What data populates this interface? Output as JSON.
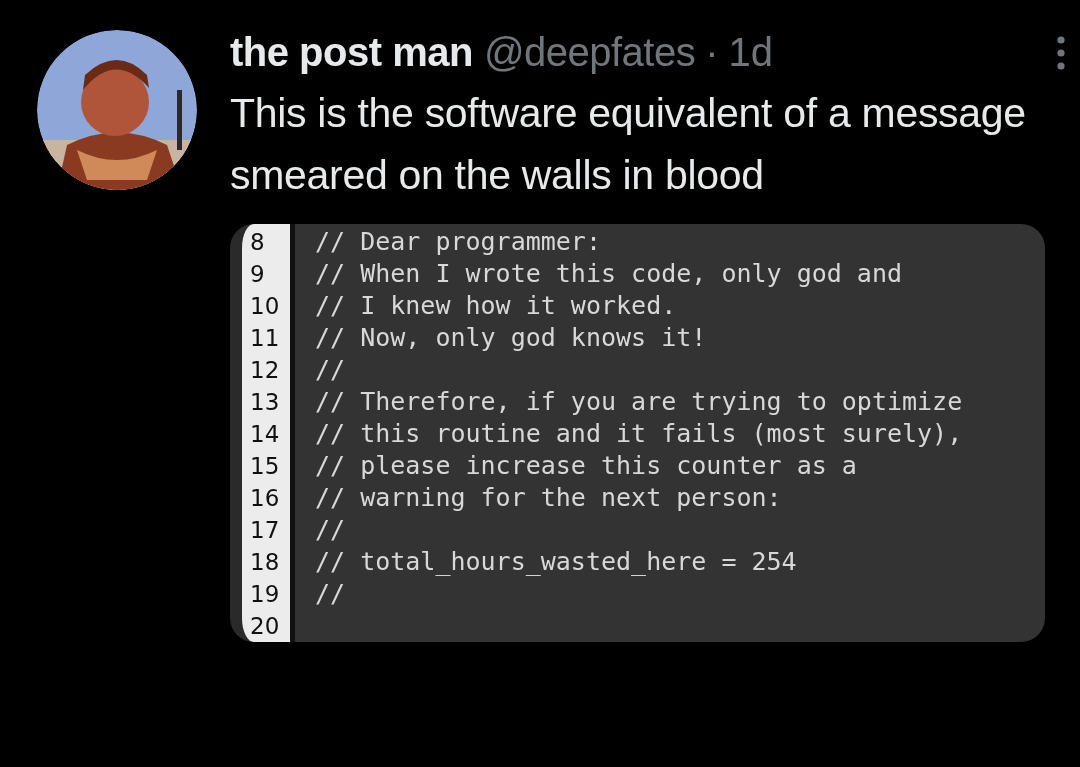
{
  "post": {
    "author": "the post man",
    "handle": "@deepfates",
    "separator": "·",
    "time": "1d",
    "text": "This is the software equivalent of a message smeared on the walls in blood",
    "code_lines": [
      {
        "number": "8",
        "code": "// Dear programmer:"
      },
      {
        "number": "9",
        "code": "// When I wrote this code, only god and"
      },
      {
        "number": "10",
        "code": "// I knew how it worked."
      },
      {
        "number": "11",
        "code": "// Now, only god knows it!"
      },
      {
        "number": "12",
        "code": "//"
      },
      {
        "number": "13",
        "code": "// Therefore, if you are trying to optimize"
      },
      {
        "number": "14",
        "code": "// this routine and it fails (most surely),"
      },
      {
        "number": "15",
        "code": "// please increase this counter as a"
      },
      {
        "number": "16",
        "code": "// warning for the next person:"
      },
      {
        "number": "17",
        "code": "//"
      },
      {
        "number": "18",
        "code": "// total_hours_wasted_here = 254"
      },
      {
        "number": "19",
        "code": "//"
      },
      {
        "number": "20"
      }
    ]
  }
}
